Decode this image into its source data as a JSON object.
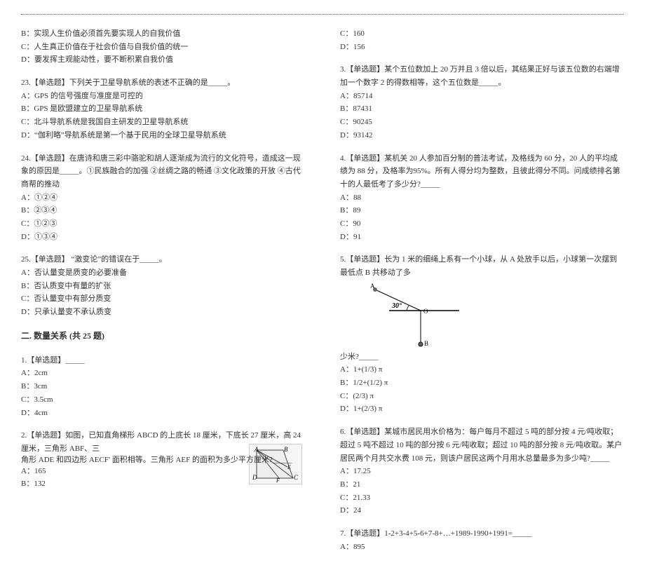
{
  "left": {
    "q_top": {
      "B": "B：实现人生价值必须首先要实现人的自我价值",
      "C": "C：人生真正价值在于社会价值与自我价值的统一",
      "D": "D：要发挥主观能动性，要不断积累自我价值"
    },
    "q23": {
      "stem": "23.【单选题】下列关于卫星导航系统的表述不正确的是_____。",
      "A": "A：GPS 的信号强度与准度是可控的",
      "B": "B：GPS 是欧盟建立的卫星导航系统",
      "C": "C：北斗导航系统是我国自主研发的卫星导航系统",
      "D": "D：“伽利略”导航系统是第一个基于民用的全球卫星导航系统"
    },
    "q24": {
      "stem": "24.【单选题】在唐诗和唐三彩中骆驼和胡人逐渐成为流行的文化符号，造成这一现象的原因是_____。①民族融合的加强  ②丝绸之路的畅通  ③文化政策的开放  ④古代商帮的推动",
      "A": "A：①②④",
      "B": "B：②③④",
      "C": "C：①②③",
      "D": "D：①③④"
    },
    "q25": {
      "stem": "25.【单选题】  “激变论”的错误在于_____。",
      "A": "A：否认量变是质变的必要准备",
      "B": "B：否认质变中有量的扩张",
      "C": "C：否认量变中有部分质变",
      "D": "D：只承认量变不承认质变"
    },
    "section": "二. 数量关系 (共 25 题)",
    "q1": {
      "stem": "1.【单选题】_____",
      "A": "A：2cm",
      "B": "B：3cm",
      "C": "C：3.5cm",
      "D": "D：4cm"
    },
    "q2": {
      "stem_a": "2.【单选题】如图，已知直角梯形 ABCD 的上底长 18 厘米，下底长 27 厘米，高 24 厘米，三角形 ABF、三",
      "stem_b": "角形 ADE 和四边形 AECF' 面积相等。三角形 AEF 的面积为多少平方厘米?_____",
      "A": "A：165",
      "B": "B：132"
    }
  },
  "right": {
    "q2r": {
      "C": "C：160",
      "D": "D：156"
    },
    "q3": {
      "stem": "3.【单选题】某个五位数加上 20 万并且 3 倍以后，其结果正好与该五位数的右端增加一个数字 2 的得数相等，这个五位数是_____。",
      "A": "A：85714",
      "B": "B：87431",
      "C": "C：90245",
      "D": "D：93142"
    },
    "q4": {
      "stem": "4.【单选题】某机关 20 人参加百分制的普法考试，及格线为 60 分，20 人的平均成绩为 88 分，及格率为95%。所有人得分均为整数，且彼此得分不同。问成绩排名第十的人最低考了多少分?_____",
      "A": "A：88",
      "B": "B：89",
      "C": "C：90",
      "D": "D：91"
    },
    "q5": {
      "stem": "5.【单选题】长为 1 米的细绳上系有一个小球，从 A 处放手以后，小球第一次摆到最低点 B 共移动了多",
      "angle": "30°",
      "tail": "少米?_____",
      "A": "A：1+(1/3) π",
      "B": "B：1/2+(1/2) π",
      "C": "C：(2/3) π",
      "D": "D：1+(2/3) π"
    },
    "q6": {
      "stem": "6.【单选题】某城市居民用水价格为：每户每月不超过 5 吨的部分按 4 元/吨收取；超过 5 吨不超过 10 吨的部分按 6 元/吨收取；超过 10 吨的部分按 8 元/吨收取。某户居民两个月共交水费 108 元，则该户居民这两个月用水总量最多为多少吨?_____",
      "A": "A：17.25",
      "B": "B：21",
      "C": "C：21.33",
      "D": "D：24"
    },
    "q7": {
      "stem": "7.【单选题】1-2+3-4+5-6+7-8+…+1989-1990+1991=_____",
      "A": "A：895"
    }
  }
}
